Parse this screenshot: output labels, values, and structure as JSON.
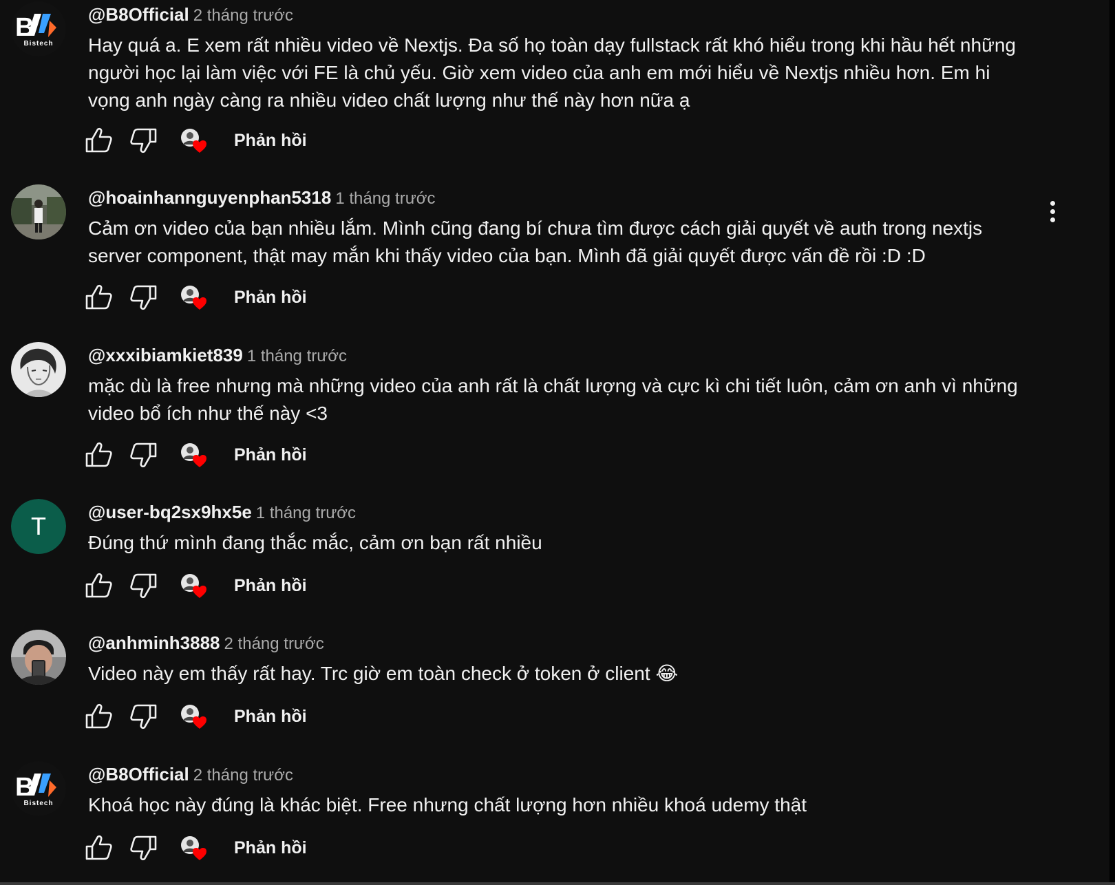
{
  "comments": [
    {
      "author": "@B8Official",
      "time": "2 tháng trước",
      "text": "Hay quá a. E xem rất nhiều video về Nextjs. Đa số họ toàn dạy fullstack rất khó hiểu trong khi hầu hết những người học lại làm việc với FE là chủ yếu. Giờ xem video của anh em mới hiểu về Nextjs nhiều hơn. Em hi vọng anh ngày càng ra nhiều video chất lượng như thế này hơn nữa ạ",
      "avatar": "bistech-logo",
      "avatar_logo_text": "Bistech",
      "reply_label": "Phản hồi"
    },
    {
      "author": "@hoainhannguyenphan5318",
      "time": "1 tháng trước",
      "text": "Cảm ơn video của bạn nhiều lắm. Mình cũng đang bí chưa tìm được cách giải quyết về auth trong nextjs server component, thật may mắn khi thấy video của bạn. Mình đã giải quyết được vấn đề rồi :D :D",
      "avatar": "photo-person-outdoor",
      "reply_label": "Phản hồi"
    },
    {
      "author": "@xxxibiamkiet839",
      "time": "1 tháng trước",
      "text": "mặc dù là free nhưng mà những video của anh rất là chất lượng và cực kì chi tiết luôn, cảm ơn anh vì những video bổ ích như thế này <3",
      "avatar": "anime-sketch",
      "reply_label": "Phản hồi"
    },
    {
      "author": "@user-bq2sx9hx5e",
      "time": "1 tháng trước",
      "text": "Đúng thứ mình đang thắc mắc, cảm ơn bạn rất nhiều",
      "avatar": "letter",
      "avatar_letter": "T",
      "avatar_color": "#0b5d4a",
      "reply_label": "Phản hồi"
    },
    {
      "author": "@anhminh3888",
      "time": "2 tháng trước",
      "text": "Video này em thấy rất hay. Trc giờ em toàn check ở token ở client 😂",
      "avatar": "photo-selfie",
      "reply_label": "Phản hồi"
    },
    {
      "author": "@B8Official",
      "time": "2 tháng trước",
      "text": "Khoá học này đúng là khác biệt. Free nhưng chất lượng hơn nhiều khoá udemy thật",
      "avatar": "bistech-logo",
      "avatar_logo_text": "Bistech",
      "reply_label": "Phản hồi"
    }
  ],
  "colors": {
    "background": "#0f0f0f",
    "text_primary": "#f1f1f1",
    "text_secondary": "#aaaaaa",
    "heart": "#ff0000"
  }
}
